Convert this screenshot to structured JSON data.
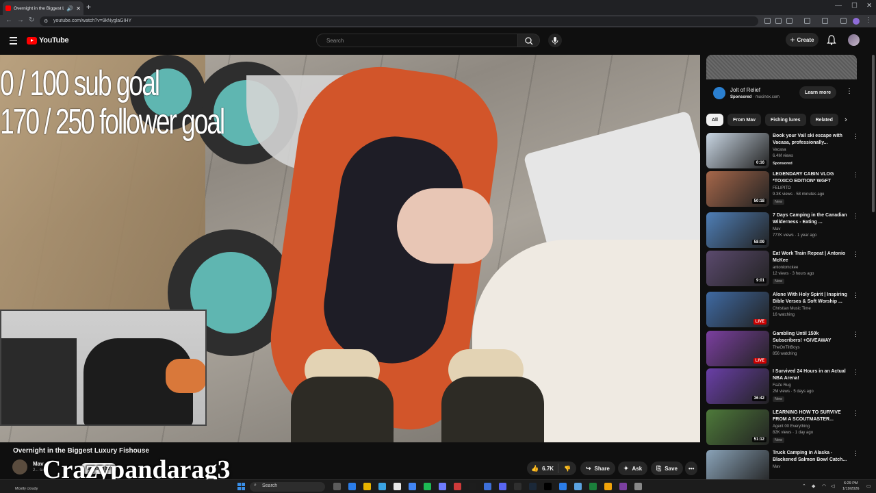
{
  "browser": {
    "tab_title": "Overnight in the Biggest Lu",
    "url": "youtube.com/watch?v=9kNyglaGIHY"
  },
  "header": {
    "logo_text": "YouTube",
    "search_placeholder": "Search",
    "create_label": "Create"
  },
  "video": {
    "overlay_line1": "0 / 100 sub goal",
    "overlay_line2": "170 / 250 follower goal",
    "title": "Overnight in the Biggest Luxury Fishouse",
    "channel_name": "Mav",
    "channel_subs": "2... subs",
    "subscribe_label": "Subscribe",
    "streamer_watermark": "Crazypandarag3",
    "like_count": "6.7K",
    "share_label": "Share",
    "ask_label": "Ask",
    "save_label": "Save"
  },
  "ad": {
    "title": "Jolt of Relief",
    "sponsored": "Sponsored",
    "domain": "mucinex.com",
    "cta": "Learn more"
  },
  "chips": [
    "All",
    "From Mav",
    "Fishing lures",
    "Related"
  ],
  "recommendations": [
    {
      "title": "Book your Vail ski escape with Vacasa, professionally...",
      "channel": "Vacasa",
      "meta": "6.4M views",
      "badge": "Sponsored",
      "duration": "0:16",
      "color": "#c9d6e3"
    },
    {
      "title": "LEGENDARY CABIN VLOG *TOXICO EDITION* WGFT",
      "channel": "FELIPITO",
      "meta": "9.3K views · 58 minutes ago",
      "badge": "New",
      "duration": "50:18",
      "color": "#a6674a"
    },
    {
      "title": "7 Days Camping in the Canadian Wilderness - Eating ...",
      "channel": "Mav",
      "meta": "777K views · 1 year ago",
      "badge": "",
      "duration": "58:09",
      "color": "#4f7fb7"
    },
    {
      "title": "Eat Work Train Repeat | Antonio McKee",
      "channel": "antoniomckee",
      "meta": "12 views · 3 hours ago",
      "badge": "New",
      "duration": "9:01",
      "color": "#5b4a6e"
    },
    {
      "title": "Alone With Holy Spirit | Inspiring Bible Verses & Soft Worship ...",
      "channel": "Christian Music Time",
      "meta": "16 watching",
      "badge": "",
      "duration": "LIVE",
      "color": "#3f6aa3"
    },
    {
      "title": "Gambling Until 150k Subscribers! +GIVEAWAY",
      "channel": "TheOnTiltBoys",
      "meta": "856 watching",
      "badge": "",
      "duration": "LIVE",
      "color": "#7b3fa0"
    },
    {
      "title": "I Survived 24 Hours in an Actual NBA Arena!",
      "channel": "FaZe Rug",
      "meta": "2M views · 5 days ago",
      "badge": "New",
      "duration": "36:42",
      "color": "#6a3fa8"
    },
    {
      "title": "LEARNING HOW TO SURVIVE FROM A SCOUTMASTER...",
      "channel": "Agent 00 Everything",
      "meta": "82K views · 1 day ago",
      "badge": "New",
      "duration": "51:12",
      "color": "#4e7a3a"
    },
    {
      "title": "Truck Camping in Alaska - Blackened Salmon Bowl Catch...",
      "channel": "Mav",
      "meta": "",
      "badge": "",
      "duration": "",
      "color": "#8aa3b8"
    }
  ],
  "taskbar": {
    "weather": "Mostly cloudy",
    "search_label": "Search",
    "time": "6:29 PM",
    "date": "1/19/2026"
  }
}
